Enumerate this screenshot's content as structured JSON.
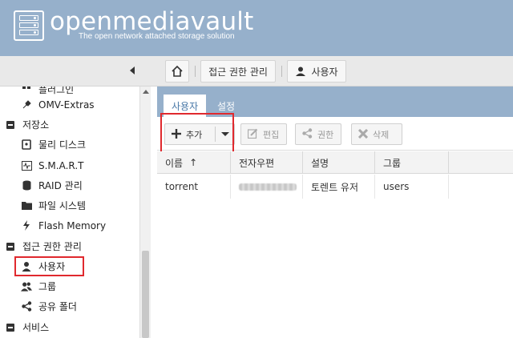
{
  "header": {
    "app_name": "openmediavault",
    "tagline": "The open network attached storage solution"
  },
  "breadcrumb": {
    "items": [
      "접근 권한 관리",
      "사용자"
    ]
  },
  "sidebar": {
    "partial_top_label": "플러그인",
    "items": [
      {
        "label": "OMV-Extras",
        "icon": "puzzle-icon",
        "type": "item"
      },
      {
        "label": "저장소",
        "icon": "minus-square-icon",
        "type": "group"
      },
      {
        "label": "물리 디스크",
        "icon": "disk-icon",
        "type": "item"
      },
      {
        "label": "S.M.A.R.T",
        "icon": "pulse-icon",
        "type": "item"
      },
      {
        "label": "RAID 관리",
        "icon": "database-icon",
        "type": "item"
      },
      {
        "label": "파일 시스템",
        "icon": "folder-icon",
        "type": "item"
      },
      {
        "label": "Flash Memory",
        "icon": "lightning-icon",
        "type": "item"
      },
      {
        "label": "접근 권한 관리",
        "icon": "minus-square-icon",
        "type": "group"
      },
      {
        "label": "사용자",
        "icon": "user-icon",
        "type": "item",
        "selected": true
      },
      {
        "label": "그룹",
        "icon": "users-icon",
        "type": "item"
      },
      {
        "label": "공유 폴더",
        "icon": "share-icon",
        "type": "item"
      },
      {
        "label": "서비스",
        "icon": "minus-square-icon",
        "type": "group"
      }
    ]
  },
  "tabs": [
    {
      "label": "사용자",
      "active": true
    },
    {
      "label": "설정",
      "active": false
    }
  ],
  "actions": {
    "add": "추가",
    "edit": "편집",
    "privileges": "권한",
    "delete": "삭제"
  },
  "grid": {
    "columns": [
      "이름",
      "전자우편",
      "설명",
      "그룹"
    ],
    "sort_indicator": "↑",
    "rows": [
      {
        "name": "torrent",
        "email": "",
        "description": "토렌트 유저",
        "groups": "users"
      }
    ]
  },
  "colors": {
    "header_bg": "#96b0cb",
    "highlight": "#e0292e",
    "tab_active_text": "#4a79a8"
  }
}
